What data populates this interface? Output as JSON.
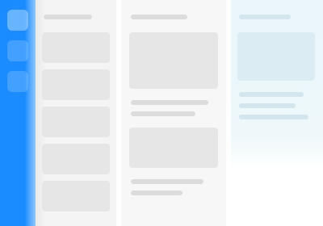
{
  "app": {
    "colors": {
      "sidebar": "#1a8cff",
      "panel_a": "#f4f4f4",
      "panel_b": "#f7f7f7",
      "panel_c": "#eaf6fb"
    },
    "sidebar": {
      "items": [
        {
          "icon": "home-icon"
        },
        {
          "icon": "search-icon"
        },
        {
          "icon": "settings-icon"
        }
      ]
    }
  }
}
